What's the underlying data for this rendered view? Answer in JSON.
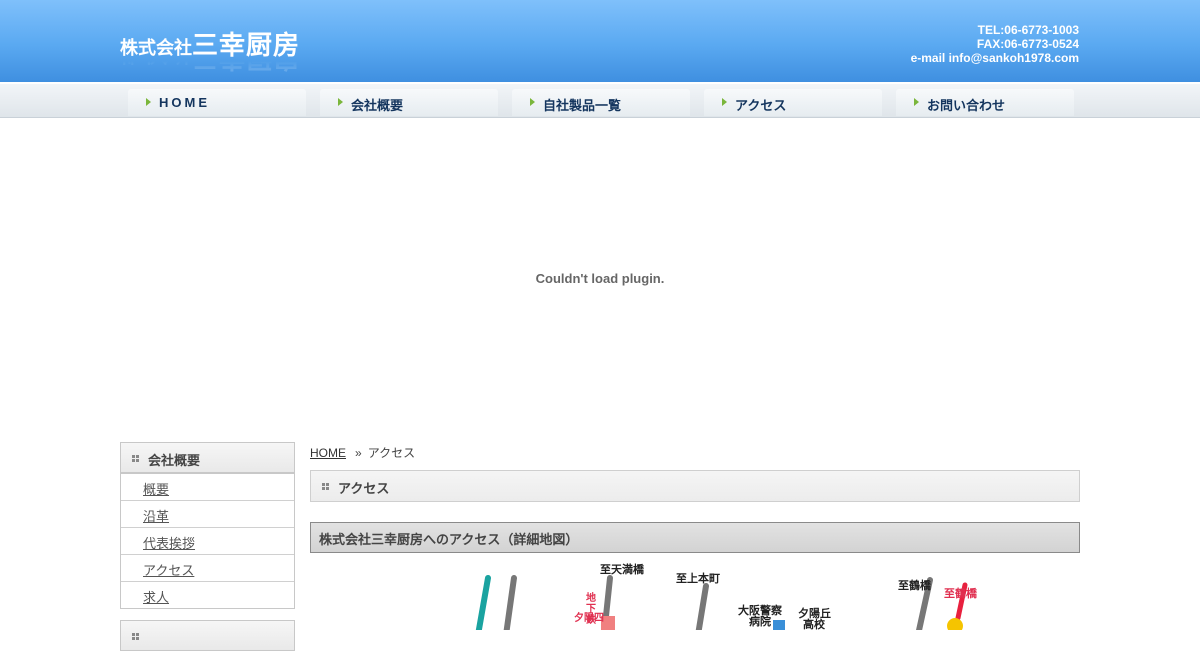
{
  "header": {
    "logo_small": "株式会社",
    "logo_big": "三幸厨房",
    "tel": "TEL:06-6773-1003",
    "fax": "FAX:06-6773-0524",
    "email": "e-mail info@sankoh1978.com"
  },
  "nav": {
    "items": [
      {
        "label": "HOME"
      },
      {
        "label": "会社概要"
      },
      {
        "label": "自社製品一覧"
      },
      {
        "label": "アクセス"
      },
      {
        "label": "お問い合わせ"
      }
    ]
  },
  "plugin": {
    "message": "Couldn't load plugin."
  },
  "sidebar": {
    "section1_title": "会社概要",
    "items": [
      {
        "label": "概要"
      },
      {
        "label": "沿革"
      },
      {
        "label": "代表挨拶"
      },
      {
        "label": "アクセス"
      },
      {
        "label": "求人"
      }
    ]
  },
  "breadcrumb": {
    "home": "HOME",
    "separator": "»",
    "current": "アクセス"
  },
  "main": {
    "title": "アクセス",
    "subtitle": "株式会社三幸厨房へのアクセス（詳細地図）"
  },
  "map": {
    "labels": {
      "tenmabashi": "至天満橋",
      "uehonmachi": "至上本町",
      "subway": "地下鉄",
      "station": "夕陽四",
      "police_hospital_1": "大阪警察",
      "police_hospital_2": "病院",
      "yuhigaoka_1": "夕陽丘",
      "yuhigaoka_2": "高校",
      "tsuruhashi_gray": "至鶴橋",
      "tsuruhashi_red": "至鶴橋"
    },
    "colors": {
      "teal": "#1aa3a0",
      "gray": "#777777",
      "red": "#e8203e",
      "pink": "#f08080",
      "yellow": "#f5c400",
      "hospital_blue": "#3a8fd8"
    }
  },
  "colors": {
    "header_blue": "#5aa9f1",
    "nav_text": "#14355e",
    "nav_arrow": "#7ab63b"
  }
}
